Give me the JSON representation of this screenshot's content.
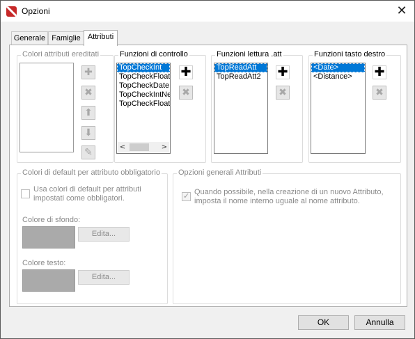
{
  "window": {
    "title": "Opzioni"
  },
  "tabs": [
    "Generale",
    "Famiglie",
    "Attributi"
  ],
  "inherited": {
    "title": "Colori attributi ereditati",
    "buttons": [
      "plus-icon",
      "close-icon",
      "arrow-up-icon",
      "arrow-down-icon",
      "pencil-icon"
    ]
  },
  "control_functions": {
    "title": "Funzioni di controllo",
    "items": [
      "TopCheckInt",
      "TopCheckFloat",
      "TopCheckDate",
      "TopCheckIntNe",
      "TopCheckFloat"
    ]
  },
  "read_functions": {
    "title": "Funzioni lettura .att",
    "items": [
      "TopReadAtt",
      "TopReadAtt2"
    ]
  },
  "right_key_functions": {
    "title": "Funzioni tasto destro",
    "items": [
      "<Date>",
      "<Distance>"
    ]
  },
  "defaults": {
    "title": "Colori di default per attributo obbligatorio",
    "checkbox_label_1": "Usa colori di default per attributi",
    "checkbox_label_2": "impostati come obbligatori.",
    "bg_label": "Colore di sfondo:",
    "text_label": "Colore testo:",
    "edit_label": "Edita...",
    "swatch_color": "#aaaaaa"
  },
  "general": {
    "title": "Opzioni generali Attributi",
    "line1": "Quando possibile, nella creazione di un nuovo Attributo,",
    "line2": "imposta il nome interno uguale al nome attributo."
  },
  "footer": {
    "ok": "OK",
    "cancel": "Annulla"
  },
  "icons": {
    "plus": "✚",
    "close": "✖",
    "up": "⬆",
    "down": "⬇",
    "pencil": "✎",
    "left": "<",
    "right": ">",
    "x": "✕"
  }
}
